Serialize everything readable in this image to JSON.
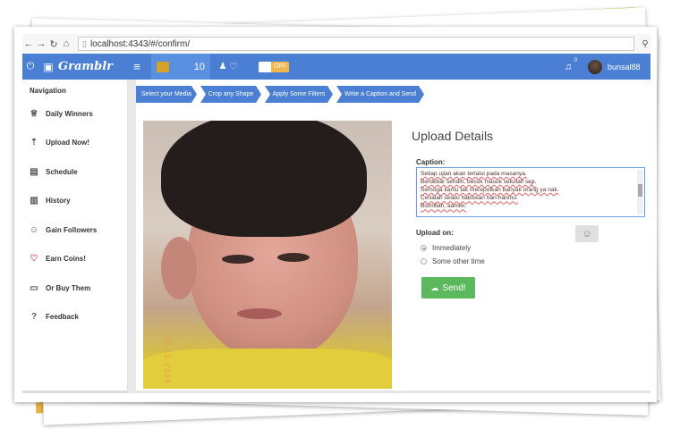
{
  "browser": {
    "url": "localhost:4343/#/confirm/",
    "nav_icons": [
      "back-icon",
      "forward-icon",
      "reload-icon",
      "home-icon"
    ]
  },
  "header": {
    "logo_text": "Gramblr",
    "coins": "10",
    "toggle_label": "OFF",
    "notification_count": "0",
    "username": "bunsal88",
    "colors": {
      "header_bg": "#4a7fd4",
      "toggle_off": "#f0b54d"
    }
  },
  "sidebar": {
    "title": "Navigation",
    "items": [
      {
        "label": "Daily Winners",
        "icon": "trophy-icon"
      },
      {
        "label": "Upload Now!",
        "icon": "upload-icon"
      },
      {
        "label": "Schedule",
        "icon": "calendar-icon"
      },
      {
        "label": "History",
        "icon": "history-icon"
      },
      {
        "label": "Gain Followers",
        "icon": "user-icon"
      },
      {
        "label": "Earn Coins!",
        "icon": "heart-icon"
      },
      {
        "label": "Or Buy Them",
        "icon": "wallet-icon"
      },
      {
        "label": "Feedback",
        "icon": "question-icon"
      }
    ]
  },
  "steps": [
    {
      "label": "Select your Media"
    },
    {
      "label": "Crop any Shape"
    },
    {
      "label": "Apply Some Filters"
    },
    {
      "label": "Write a Caption and Send"
    }
  ],
  "photo": {
    "date_stamp": "22 12 2016"
  },
  "upload": {
    "title": "Upload Details",
    "caption_label": "Caption:",
    "caption_lines": [
      "Setiap ujian akan terlalui pada masanya.",
      "Berdebar sendiri, besok masuk sekolah lagi.",
      "Semoga kamu tak merepotkan banyak orang ya nak.",
      "Ceriaiah selalu habiskan hari-harimu.",
      "Bismillah, aamiin."
    ],
    "upload_on_label": "Upload on:",
    "options": [
      {
        "label": "Immediately",
        "selected": true
      },
      {
        "label": "Some other time",
        "selected": false
      }
    ],
    "send_label": "Send!",
    "send_color": "#5cb85c"
  }
}
